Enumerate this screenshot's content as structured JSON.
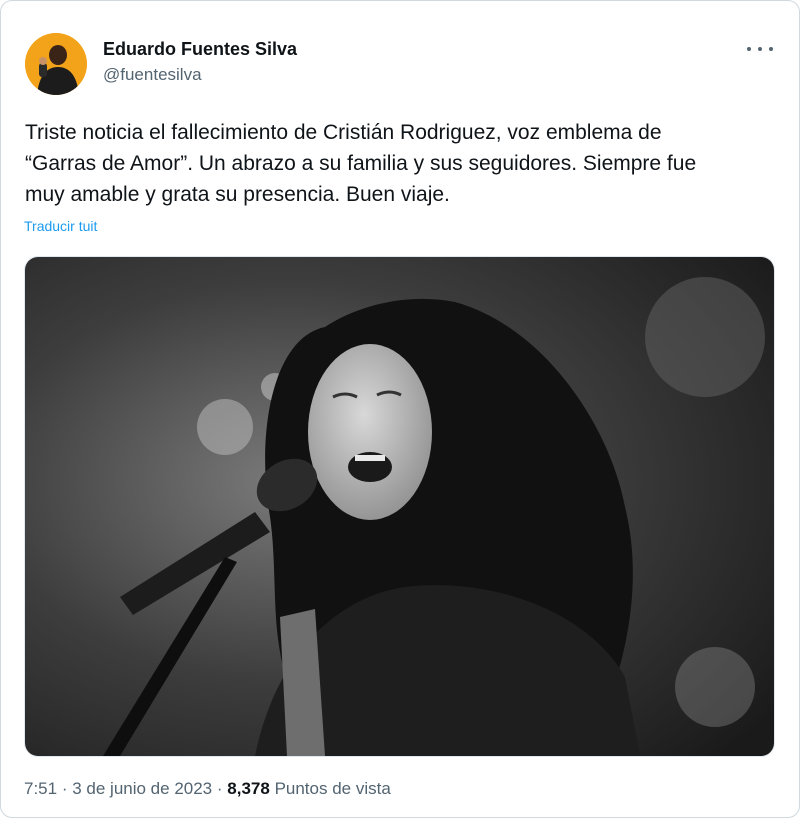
{
  "author": {
    "display_name": "Eduardo Fuentes Silva",
    "handle": "@fuentesilva",
    "avatar_color": "#f2a31a"
  },
  "tweet": {
    "text_lines": [
      "Triste noticia el fallecimiento de Cristián Rodriguez, voz emblema de",
      "“Garras de Amor”. Un abrazo a su familia y sus seguidores. Siempre fue",
      "muy amable y grata su presencia. Buen viaje."
    ],
    "translate_label": "Traducir tuit",
    "media_icon": "photo-singer-microphone"
  },
  "meta": {
    "time": "7:51",
    "sep1": "·",
    "date": "3 de junio de 2023",
    "sep2": "·",
    "views_count": "8,378",
    "views_label": "Puntos de vista"
  },
  "colors": {
    "link": "#1d9bf0",
    "secondary_text": "#536471",
    "primary_text": "#0f1419"
  }
}
